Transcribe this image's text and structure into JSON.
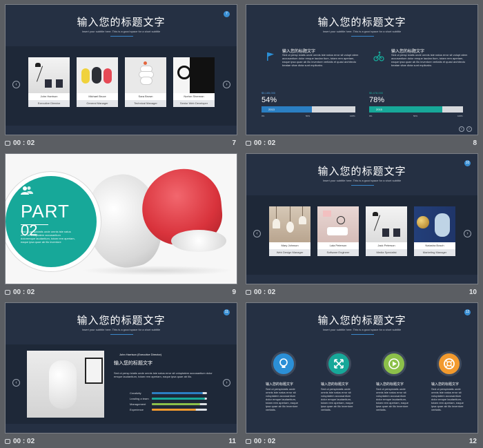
{
  "slide_title": "输入您的标题文字",
  "slide_subtitle": "Insert your subtitle here. This is a good space for a short subtitle",
  "heading_small": "输入您的标题文字",
  "body_text": "Sed ut persp iciatis unde omnis iste natus error sit volupt atem accusantium dolor emque laudan tium, totam rem aperiam, eaque ipsa quae ab illo inventore veritatis et quasi architecto beatae vitae dicta sunt explicabo.",
  "thumbs": [
    {
      "time": "00 : 02",
      "num": "7"
    },
    {
      "time": "00 : 02",
      "num": "8"
    },
    {
      "time": "00 : 02",
      "num": "9"
    },
    {
      "time": "00 : 02",
      "num": "10"
    },
    {
      "time": "00 : 02",
      "num": "11"
    },
    {
      "time": "00 : 02",
      "num": "12"
    }
  ],
  "slide7": {
    "badge": "7",
    "team": [
      {
        "name": "John Harrison",
        "role": "Executive Director"
      },
      {
        "name": "Michael  Bruce",
        "role": "General Manager"
      },
      {
        "name": "Sara Brown",
        "role": "Technical Manager"
      },
      {
        "name": "Norton Sherman",
        "role": "Senior Web Developer"
      }
    ]
  },
  "slide8": {
    "stats": [
      {
        "amount": "$5,185,000",
        "percent": "54%",
        "year": "2013",
        "fill": 0.54,
        "color": "#2b7fc3",
        "ticks": [
          "0%",
          "50%",
          "100%"
        ]
      },
      {
        "amount": "$5,478,000",
        "percent": "78%",
        "year": "2015",
        "fill": 0.78,
        "color": "#17a899",
        "ticks": [
          "0%",
          "50%",
          "100%"
        ]
      }
    ],
    "icons": [
      "flag-icon",
      "cyclist-icon"
    ]
  },
  "slide9": {
    "part_label": "PART",
    "part_number": "02",
    "part_text": "Sed ut perspiciatis unde omnis iste natus error sit voluptatem accusantium doloremque laudantium, totam rem aperiam, eaque ipsa quae ab illo inventore"
  },
  "slide10": {
    "badge": "10",
    "team": [
      {
        "name": "Mary Johnson",
        "role": "Web Design Manager"
      },
      {
        "name": "Lala  Peterson",
        "role": "Software Engineer"
      },
      {
        "name": "Jack Peterson",
        "role": "Media Specialist"
      },
      {
        "name": "Natasha Bosch",
        "role": "Marketing Manager"
      }
    ]
  },
  "slide11": {
    "badge": "11",
    "person": "John Harrison (Executive Director)",
    "text": "Sed ut persp iciatis unde omnis iste natus error sit voluptatem accusantium dolor emque laudantium, totam rem aperiam, eaque ipsa quae ab illo.",
    "skills": [
      {
        "label": "Creativity",
        "value": 0.92,
        "color": "#2b7fc3"
      },
      {
        "label": "Leading a team",
        "value": 0.96,
        "color": "#17a899"
      },
      {
        "label": "Management",
        "value": 0.88,
        "color": "#8cc04a"
      },
      {
        "label": "Experience",
        "value": 0.8,
        "color": "#f29a2e"
      }
    ]
  },
  "slide12": {
    "badge": "12",
    "features": [
      {
        "icon": "lightbulb-icon",
        "color": "#2b8fd6",
        "title": "输入您的标题文字"
      },
      {
        "icon": "expand-arrows-icon",
        "color": "#17a899",
        "title": "输入您的标题文字"
      },
      {
        "icon": "play-icon",
        "color": "#8cc04a",
        "title": "输入您的标题文字"
      },
      {
        "icon": "lifebuoy-icon",
        "color": "#f29a2e",
        "title": "输入您的标题文字"
      }
    ],
    "feature_text": "Sed ut perspiciatis unde omnis iste natus error sit voluptatem accusantium dolor emque laudantium, totam rem aperiam, eaque ipsa quae ab illo inventore veritatis."
  },
  "colors": {
    "bg": "#253043",
    "band": "#1e2838",
    "accent_blue": "#2b7fc3",
    "accent_teal": "#17a899"
  }
}
